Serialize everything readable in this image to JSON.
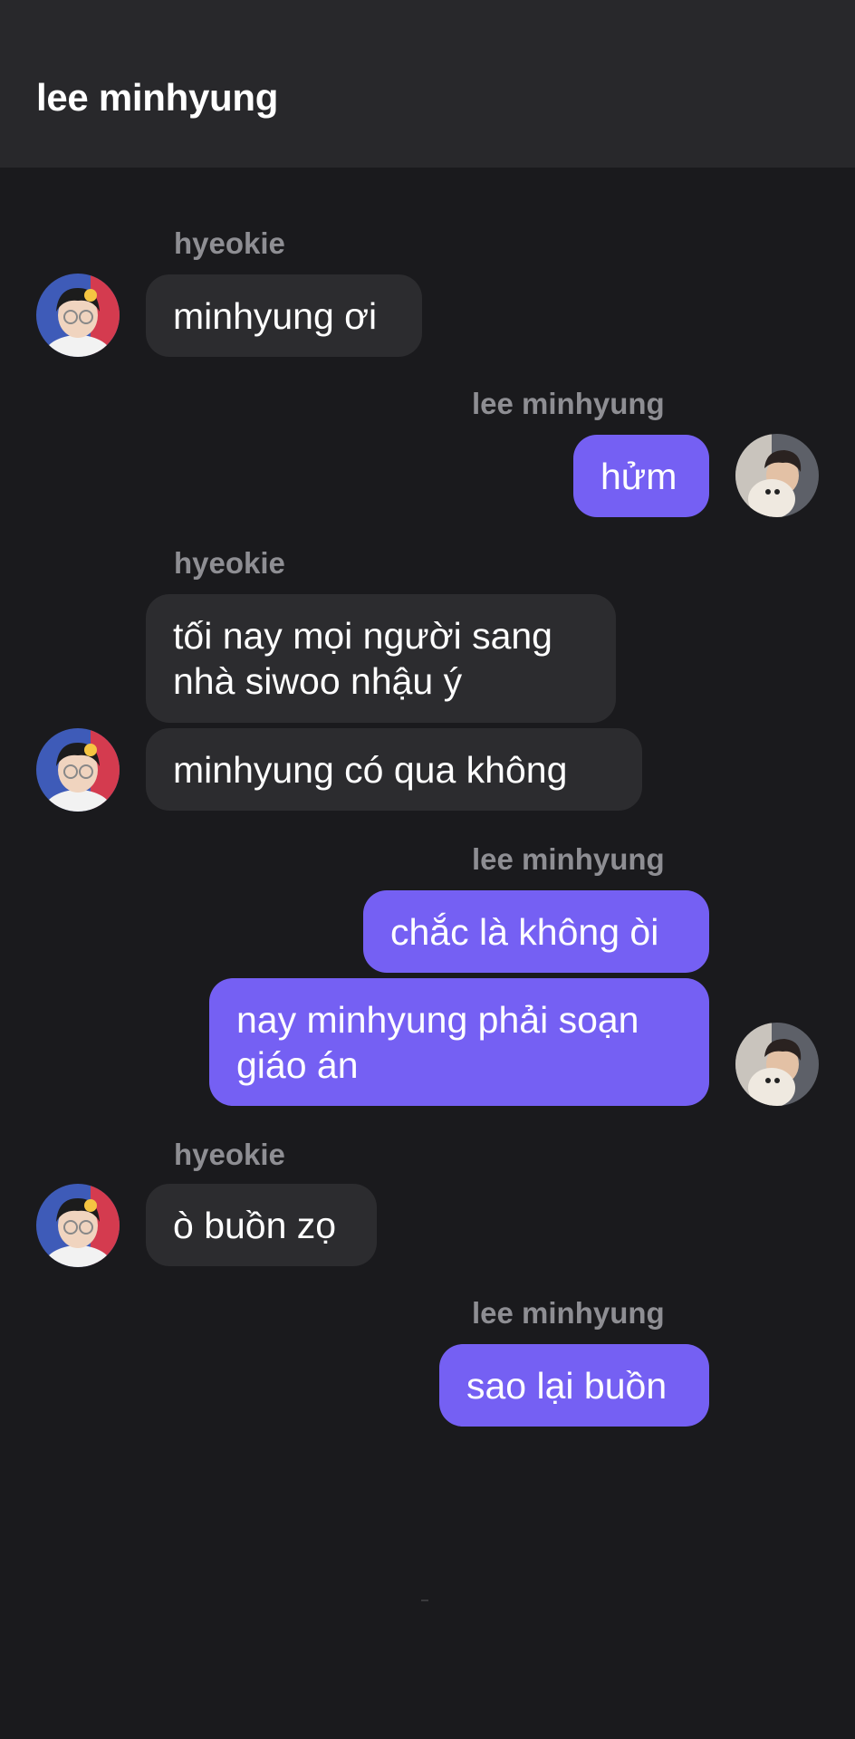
{
  "header": {
    "title": "lee minhyung"
  },
  "messages": [
    {
      "sender": "hyeokie",
      "direction": "incoming",
      "bubbles": [
        "minhyung ơi"
      ]
    },
    {
      "sender": "lee minhyung",
      "direction": "outgoing",
      "bubbles": [
        "hửm"
      ]
    },
    {
      "sender": "hyeokie",
      "direction": "incoming",
      "bubbles": [
        "tối nay mọi người sang nhà siwoo nhậu ý",
        "minhyung có qua không"
      ]
    },
    {
      "sender": "lee minhyung",
      "direction": "outgoing",
      "bubbles": [
        "chắc là không òi",
        "nay minhyung phải soạn giáo án"
      ]
    },
    {
      "sender": "hyeokie",
      "direction": "incoming",
      "bubbles": [
        "ò buồn zọ"
      ]
    },
    {
      "sender": "lee minhyung",
      "direction": "outgoing",
      "bubbles": [
        "sao lại buồn"
      ]
    }
  ],
  "avatars": {
    "hyeokie": "glasses-boy-avatar",
    "lee_minhyung": "boy-with-dog-avatar"
  },
  "colors": {
    "background": "#1a1a1d",
    "header": "#28282b",
    "incoming_bubble": "#2c2c2f",
    "outgoing_bubble": "#7560f3",
    "sender_name": "#8e8e93"
  }
}
